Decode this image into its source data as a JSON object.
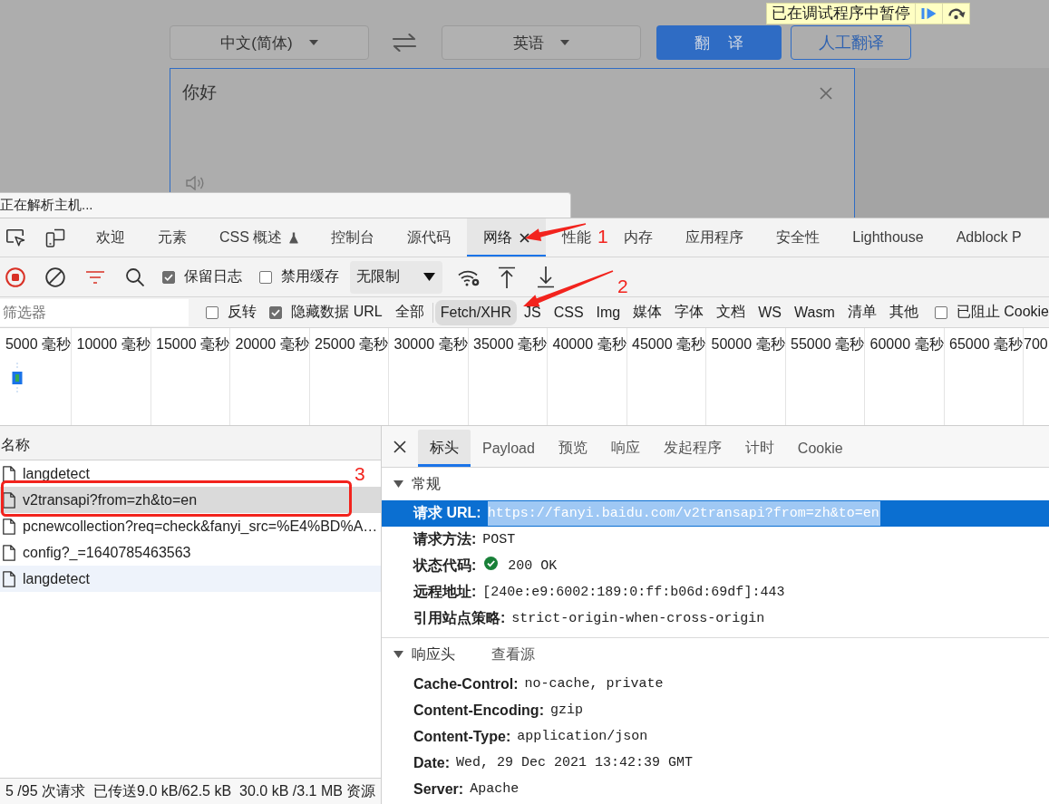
{
  "page": {
    "source_language": "中文(简体)",
    "target_language": "英语",
    "translate_button": "翻 译",
    "human_translation_button": "人工翻译",
    "source_text": "你好",
    "debugger_banner": "已在调试程序中暂停",
    "status_bubble": "正在解析主机..."
  },
  "devtools_tabs": [
    {
      "label": "欢迎",
      "selected": false,
      "experimental": false
    },
    {
      "label": "元素",
      "selected": false,
      "experimental": false
    },
    {
      "label": "CSS 概述",
      "selected": false,
      "experimental": true
    },
    {
      "label": "控制台",
      "selected": false,
      "experimental": false
    },
    {
      "label": "源代码",
      "selected": false,
      "experimental": false
    },
    {
      "label": "网络",
      "selected": true,
      "experimental": false
    },
    {
      "label": "性能",
      "selected": false,
      "experimental": false
    },
    {
      "label": "内存",
      "selected": false,
      "experimental": false
    },
    {
      "label": "应用程序",
      "selected": false,
      "experimental": false
    },
    {
      "label": "安全性",
      "selected": false,
      "experimental": false
    },
    {
      "label": "Lighthouse",
      "selected": false,
      "experimental": false
    },
    {
      "label": "Adblock P",
      "selected": false,
      "experimental": false
    }
  ],
  "network_toolbar": {
    "checkboxes": [
      {
        "label": "保留日志",
        "checked": true
      },
      {
        "label": "禁用缓存",
        "checked": false
      }
    ],
    "throttling": "无限制"
  },
  "filter_bar": {
    "placeholder": "筛选器",
    "checkboxes": [
      {
        "label": "反转",
        "checked": false
      },
      {
        "label": "隐藏数据 URL",
        "checked": true
      }
    ],
    "types": [
      {
        "label": "全部",
        "selected": false
      },
      {
        "label": "Fetch/XHR",
        "selected": true
      },
      {
        "label": "JS",
        "selected": false
      },
      {
        "label": "CSS",
        "selected": false
      },
      {
        "label": "Img",
        "selected": false
      },
      {
        "label": "媒体",
        "selected": false
      },
      {
        "label": "字体",
        "selected": false
      },
      {
        "label": "文档",
        "selected": false
      },
      {
        "label": "WS",
        "selected": false
      },
      {
        "label": "Wasm",
        "selected": false
      },
      {
        "label": "清单",
        "selected": false
      },
      {
        "label": "其他",
        "selected": false
      }
    ],
    "blocked_cookies": {
      "label": "已阻止 Cookie",
      "checked": false
    }
  },
  "timeline": {
    "tick_labels": [
      "5000 毫秒",
      "10000 毫秒",
      "15000 毫秒",
      "20000 毫秒",
      "25000 毫秒",
      "30000 毫秒",
      "35000 毫秒",
      "40000 毫秒",
      "45000 毫秒",
      "50000 毫秒",
      "55000 毫秒",
      "60000 毫秒",
      "65000 毫秒",
      "700"
    ]
  },
  "request_list": {
    "column": "名称",
    "rows": [
      {
        "name": "langdetect",
        "selected": false,
        "hovered": false
      },
      {
        "name": "v2transapi?from=zh&to=en",
        "selected": true,
        "hovered": false
      },
      {
        "name": "pcnewcollection?req=check&fanyi_src=%E4%BD%A…",
        "selected": false,
        "hovered": false
      },
      {
        "name": "config?_=1640785463563",
        "selected": false,
        "hovered": false
      },
      {
        "name": "langdetect",
        "selected": false,
        "hovered": true
      }
    ]
  },
  "summary": [
    "5 /95 次请求",
    "已传送9.0 kB/62.5 kB",
    "30.0 kB /3.1 MB 资源"
  ],
  "details": {
    "tabs": [
      {
        "label": "标头",
        "selected": true
      },
      {
        "label": "Payload",
        "selected": false
      },
      {
        "label": "预览",
        "selected": false
      },
      {
        "label": "响应",
        "selected": false
      },
      {
        "label": "发起程序",
        "selected": false
      },
      {
        "label": "计时",
        "selected": false
      },
      {
        "label": "Cookie",
        "selected": false
      }
    ],
    "sections": [
      {
        "title": "常规",
        "expanded": true,
        "headers": [
          {
            "kind": "plain",
            "name": "请求 URL:",
            "value": "https://fanyi.baidu.com/v2transapi?from=zh&to=en",
            "selected": true
          },
          {
            "kind": "plain",
            "name": "请求方法:",
            "value": "POST",
            "selected": false
          },
          {
            "kind": "status",
            "name": "状态代码:",
            "value": "200 OK",
            "selected": false
          },
          {
            "kind": "plain",
            "name": "远程地址:",
            "value": "[240e:e9:6002:189:0:ff:b06d:69df]:443",
            "selected": false
          },
          {
            "kind": "plain",
            "name": "引用站点策略:",
            "value": "strict-origin-when-cross-origin",
            "selected": false
          }
        ]
      },
      {
        "title": "响应头",
        "expanded": true,
        "link": "查看源",
        "headers": [
          {
            "name": "Cache-Control:",
            "value": "no-cache, private",
            "selected": false
          },
          {
            "name": "Content-Encoding:",
            "value": "gzip",
            "selected": false
          },
          {
            "name": "Content-Type:",
            "value": "application/json",
            "selected": false
          },
          {
            "name": "Date:",
            "value": "Wed, 29 Dec 2021 13:42:39 GMT",
            "selected": false
          },
          {
            "name": "Server:",
            "value": "Apache",
            "selected": false
          }
        ]
      }
    ]
  },
  "annotations": [
    {
      "kind": "arrow",
      "label": "1"
    },
    {
      "kind": "arrow",
      "label": "2"
    },
    {
      "kind": "frame",
      "label": "3"
    }
  ]
}
